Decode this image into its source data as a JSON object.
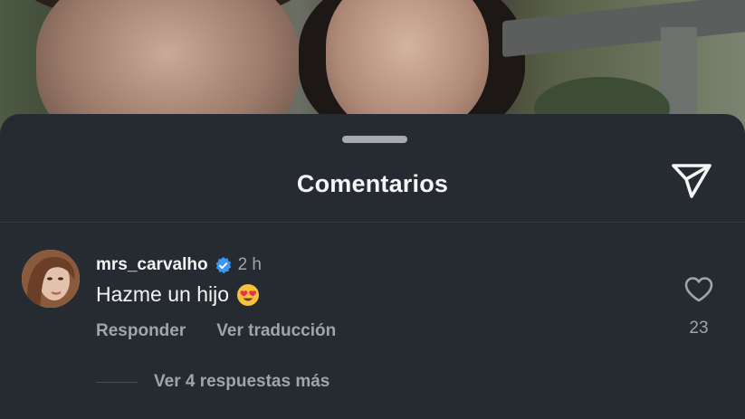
{
  "sheet": {
    "title": "Comentarios"
  },
  "comment": {
    "username": "mrs_carvalho",
    "time": "2 h",
    "text": "Hazme un hijo",
    "likes": "23",
    "actions": {
      "reply": "Responder",
      "translate": "Ver traducción"
    },
    "view_replies": "Ver 4 respuestas más"
  },
  "colors": {
    "sheet_bg": "#262a31",
    "verified_blue": "#3897f0",
    "muted_text": "#a0a4ab"
  }
}
